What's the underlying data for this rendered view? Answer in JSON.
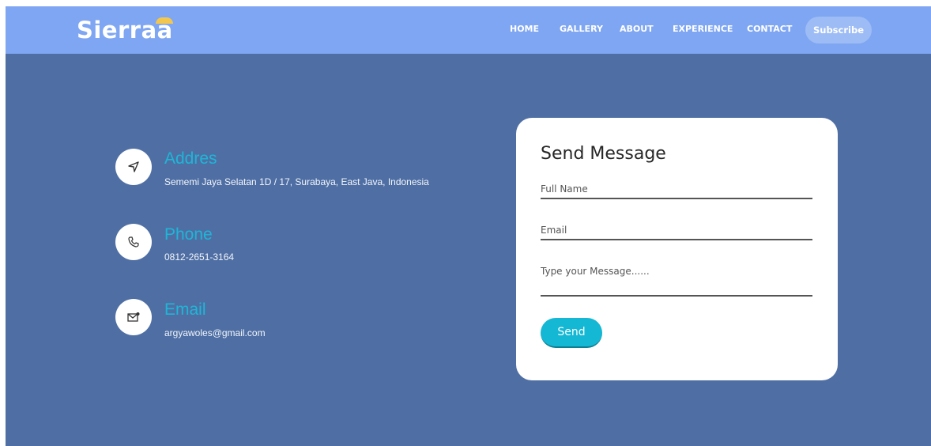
{
  "header": {
    "logo_text": "Sierraa",
    "nav": [
      {
        "label": "HOME"
      },
      {
        "label": "GALLERY"
      },
      {
        "label": "ABOUT"
      },
      {
        "label": "EXPERIENCE"
      },
      {
        "label": "CONTACT"
      }
    ],
    "subscribe_label": "Subscribe"
  },
  "contact_info": [
    {
      "icon": "navigation-arrow-icon",
      "title": "Addres",
      "text": "Sememi Jaya Selatan 1D / 17, Surabaya, East Java, Indonesia"
    },
    {
      "icon": "phone-icon",
      "title": "Phone",
      "text": "0812-2651-3164"
    },
    {
      "icon": "mail-icon",
      "title": "Email",
      "text": "argyawoles@gmail.com"
    }
  ],
  "form": {
    "title": "Send Message",
    "full_name_placeholder": "Full Name",
    "email_placeholder": "Email",
    "message_placeholder": "Type your Message......",
    "send_label": "Send"
  },
  "colors": {
    "page_background": "#4f6fa4",
    "header_background": "#7fa6f2",
    "accent": "#14b8d4",
    "logo_sun": "#f3c64e",
    "card_background": "#ffffff"
  }
}
